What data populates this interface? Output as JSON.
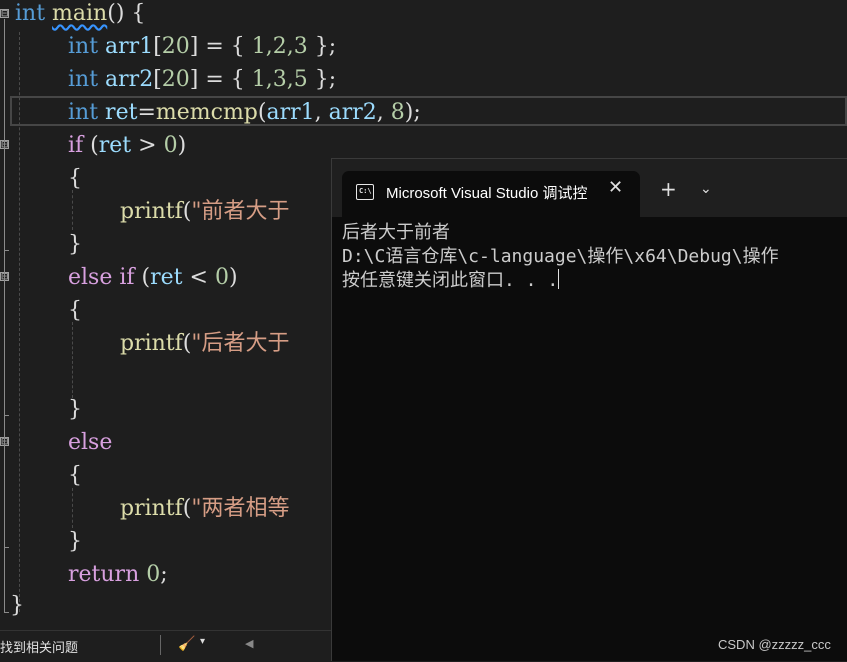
{
  "code": {
    "l1_kw": "int",
    "l1_fn": "main",
    "l1_rest": "() {",
    "l2_kw": "int",
    "l2_var": "arr1",
    "l2_p1": "[",
    "l2_n1": "20",
    "l2_p2": "] = { ",
    "l2_vals": "1,2,3",
    "l2_p3": " };",
    "l3_kw": "int",
    "l3_var": "arr2",
    "l3_p1": "[",
    "l3_n1": "20",
    "l3_p2": "] = { ",
    "l3_vals": "1,3,5",
    "l3_p3": " };",
    "l4_kw": "int",
    "l4_var": "ret",
    "l4_eq": "=",
    "l4_fn": "memcmp",
    "l4_p1": "(",
    "l4_a1": "arr1",
    "l4_c1": ", ",
    "l4_a2": "arr2",
    "l4_c2": ", ",
    "l4_n": "8",
    "l4_p2": ");",
    "l5_kw": "if",
    "l5_p1": " (",
    "l5_var": "ret",
    "l5_op": " > ",
    "l5_n": "0",
    "l5_p2": ")",
    "l6": "{",
    "l7_fn": "printf",
    "l7_p": "(",
    "l7_str": "\"前者大于",
    "l8": "}",
    "l9_kw1": "else",
    "l9_kw2": " if",
    "l9_p1": " (",
    "l9_var": "ret",
    "l9_op": " < ",
    "l9_n": "0",
    "l9_p2": ")",
    "l10": "{",
    "l11_fn": "printf",
    "l11_p": "(",
    "l11_str": "\"后者大于",
    "l13": "}",
    "l14_kw": "else",
    "l15": "{",
    "l16_fn": "printf",
    "l16_p": "(",
    "l16_str": "\"两者相等",
    "l17": "}",
    "l18_kw": "return",
    "l18_n": " 0",
    "l18_p": ";",
    "l19": "}"
  },
  "fold_icons": {
    "collapse": "⊟"
  },
  "statusbar": {
    "text": "找到相关问题",
    "brush_icon": "broom-icon",
    "dropdown_glyph": "▾",
    "scroll_left_glyph": "◀"
  },
  "terminal": {
    "tab_icon_text": "C:\\",
    "tab_title": "Microsoft Visual Studio 调试控",
    "close_glyph": "✕",
    "new_tab_glyph": "+",
    "dropdown_glyph": "⌄",
    "output_line1": "后者大于前者",
    "output_line2": "D:\\C语言仓库\\c-language\\操作\\x64\\Debug\\操作",
    "output_line3": "按任意键关闭此窗口. . ."
  },
  "watermark": "CSDN @zzzzz_ccc",
  "colors": {
    "editor_bg": "#1e1e1e",
    "keyword": "#569cd6",
    "control_keyword": "#d8a0df",
    "function": "#dcdcaa",
    "variable": "#9cdcfe",
    "number": "#b5cea8",
    "string": "#d69d85",
    "terminal_bg": "#0c0c0c"
  }
}
